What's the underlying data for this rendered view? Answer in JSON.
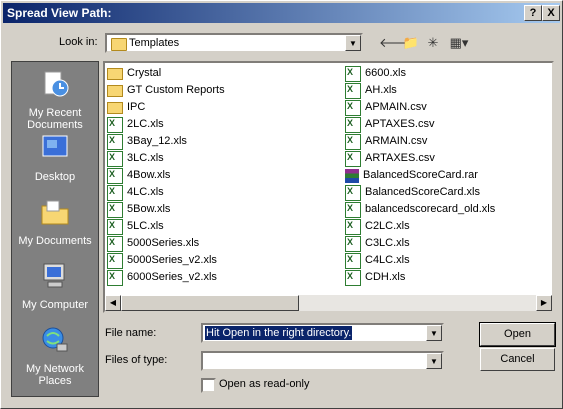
{
  "window": {
    "title": "Spread View Path:"
  },
  "titlebar_buttons": {
    "help": "?",
    "close": "X"
  },
  "lookin": {
    "label": "Look in:",
    "value": "Templates"
  },
  "places": [
    {
      "label": "My Recent Documents",
      "icon": "recent-docs-icon"
    },
    {
      "label": "Desktop",
      "icon": "desktop-icon"
    },
    {
      "label": "My Documents",
      "icon": "my-documents-icon"
    },
    {
      "label": "My Computer",
      "icon": "my-computer-icon"
    },
    {
      "label": "My Network Places",
      "icon": "network-places-icon"
    }
  ],
  "files_left": [
    {
      "name": "Crystal",
      "type": "folder"
    },
    {
      "name": "GT Custom Reports",
      "type": "folder"
    },
    {
      "name": "IPC",
      "type": "folder"
    },
    {
      "name": "2LC.xls",
      "type": "xls"
    },
    {
      "name": "3Bay_12.xls",
      "type": "xls"
    },
    {
      "name": "3LC.xls",
      "type": "xls"
    },
    {
      "name": "4Bow.xls",
      "type": "xls"
    },
    {
      "name": "4LC.xls",
      "type": "xls"
    },
    {
      "name": "5Bow.xls",
      "type": "xls"
    },
    {
      "name": "5LC.xls",
      "type": "xls"
    },
    {
      "name": "5000Series.xls",
      "type": "xls"
    },
    {
      "name": "5000Series_v2.xls",
      "type": "xls"
    },
    {
      "name": "6000Series_v2.xls",
      "type": "xls"
    }
  ],
  "files_right": [
    {
      "name": "6600.xls",
      "type": "xls"
    },
    {
      "name": "AH.xls",
      "type": "xls"
    },
    {
      "name": "APMAIN.csv",
      "type": "xls"
    },
    {
      "name": "APTAXES.csv",
      "type": "xls"
    },
    {
      "name": "ARMAIN.csv",
      "type": "xls"
    },
    {
      "name": "ARTAXES.csv",
      "type": "xls"
    },
    {
      "name": "BalancedScoreCard.rar",
      "type": "rar"
    },
    {
      "name": "BalancedScoreCard.xls",
      "type": "xls"
    },
    {
      "name": "balancedscorecard_old.xls",
      "type": "xls"
    },
    {
      "name": "C2LC.xls",
      "type": "xls"
    },
    {
      "name": "C3LC.xls",
      "type": "xls"
    },
    {
      "name": "C4LC.xls",
      "type": "xls"
    },
    {
      "name": "CDH.xls",
      "type": "xls"
    }
  ],
  "filename": {
    "label": "File name:",
    "value": "Hit Open in the right directory."
  },
  "filetype": {
    "label": "Files of type:",
    "value": ""
  },
  "readonly": {
    "label": "Open as read-only",
    "checked": false
  },
  "buttons": {
    "open": "Open",
    "cancel": "Cancel"
  }
}
